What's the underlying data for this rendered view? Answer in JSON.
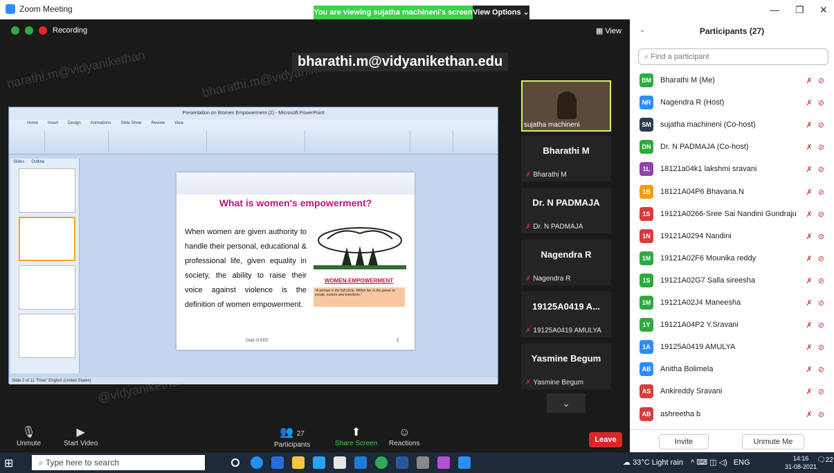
{
  "titlebar": {
    "app_title": "Zoom Meeting",
    "banner": "You are viewing sujatha machineni's screen",
    "view_options": "View Options ⌄"
  },
  "meeting": {
    "recording_label": "Recording",
    "view_label": "View",
    "shared_email": "bharathi.m@vidyanikethan.edu"
  },
  "ppt": {
    "window_title": "Presentation on Women Empowerment (2) - Microsoft PowerPoint",
    "tabs": [
      "Home",
      "Insert",
      "Design",
      "Animations",
      "Slide Show",
      "Review",
      "View"
    ],
    "panes": [
      "Slides",
      "Outline"
    ],
    "status": "Slide 2 of 11   \"Flow\"   English (United States)",
    "slide": {
      "title": "What is women's empowerment?",
      "body": "When women are given authority to handle their personal, educational & professional life, given equality in society, the ability to raise their voice against violence is the definition of women empowerment.",
      "image_label": "WOMEN-EMPOWERMENT",
      "quote": "\"A woman is the full circle. Within her is the power to create, nurture and transform.\"",
      "dept": "Dept of EEE",
      "number": "2"
    }
  },
  "videos": {
    "self_name": "sujatha machineni",
    "tiles": [
      {
        "big": "Bharathi M",
        "small": "Bharathi M"
      },
      {
        "big": "Dr. N PADMAJA",
        "small": "Dr. N PADMAJA"
      },
      {
        "big": "Nagendra R",
        "small": "Nagendra R"
      },
      {
        "big": "19125A0419  A...",
        "small": "19125A0419 AMULYA"
      },
      {
        "big": "Yasmine Begum",
        "small": "Yasmine Begum"
      }
    ]
  },
  "toolbar": {
    "unmute": "Unmute",
    "start_video": "Start Video",
    "participants": "Participants",
    "participant_count": "27",
    "share_screen": "Share Screen",
    "reactions": "Reactions",
    "leave": "Leave"
  },
  "panel": {
    "title": "Participants (27)",
    "search_placeholder": "Find a participant",
    "participants": [
      {
        "initials": "BM",
        "name": "Bharathi M (Me)",
        "color": "#2eaa3f"
      },
      {
        "initials": "NR",
        "name": "Nagendra R (Host)",
        "color": "#2d8cff"
      },
      {
        "initials": "SM",
        "name": "sujatha machineni (Co-host)",
        "color": "#2e3b4e"
      },
      {
        "initials": "DN",
        "name": "Dr. N PADMAJA (Co-host)",
        "color": "#2eaa3f"
      },
      {
        "initials": "1L",
        "name": "18121a04k1 lakshmi sravani",
        "color": "#8e44ad"
      },
      {
        "initials": "1B",
        "name": "18121A04P6 Bhavana.N",
        "color": "#f39c12"
      },
      {
        "initials": "1S",
        "name": "19121A0266-Sree Sai Nandini Gundraju",
        "color": "#d63c3c"
      },
      {
        "initials": "1N",
        "name": "19121A0294 Nandini",
        "color": "#d63c3c"
      },
      {
        "initials": "1M",
        "name": "19121A02F6 Mounika reddy",
        "color": "#2eaa3f"
      },
      {
        "initials": "1S",
        "name": "19121A02G7 Salla sireesha",
        "color": "#2eaa3f"
      },
      {
        "initials": "1M",
        "name": "19121A02J4 Maneesha",
        "color": "#2eaa3f"
      },
      {
        "initials": "1Y",
        "name": "19121A04P2 Y.Sravani",
        "color": "#2eaa3f"
      },
      {
        "initials": "1A",
        "name": "19125A0419 AMULYA",
        "color": "#2d8cff"
      },
      {
        "initials": "AB",
        "name": "Anitha Bolimela",
        "color": "#2d8cff"
      },
      {
        "initials": "AS",
        "name": "Ankireddy Sravani",
        "color": "#d63c3c"
      },
      {
        "initials": "AB",
        "name": "ashreetha b",
        "color": "#d63c3c"
      }
    ],
    "invite": "Invite",
    "unmute_me": "Unmute Me"
  },
  "taskbar": {
    "search": "Type here to search",
    "weather": "33°C Light rain",
    "lang": "ENG",
    "time": "14:16",
    "date": "31-08-2021",
    "notif_count": "22"
  }
}
